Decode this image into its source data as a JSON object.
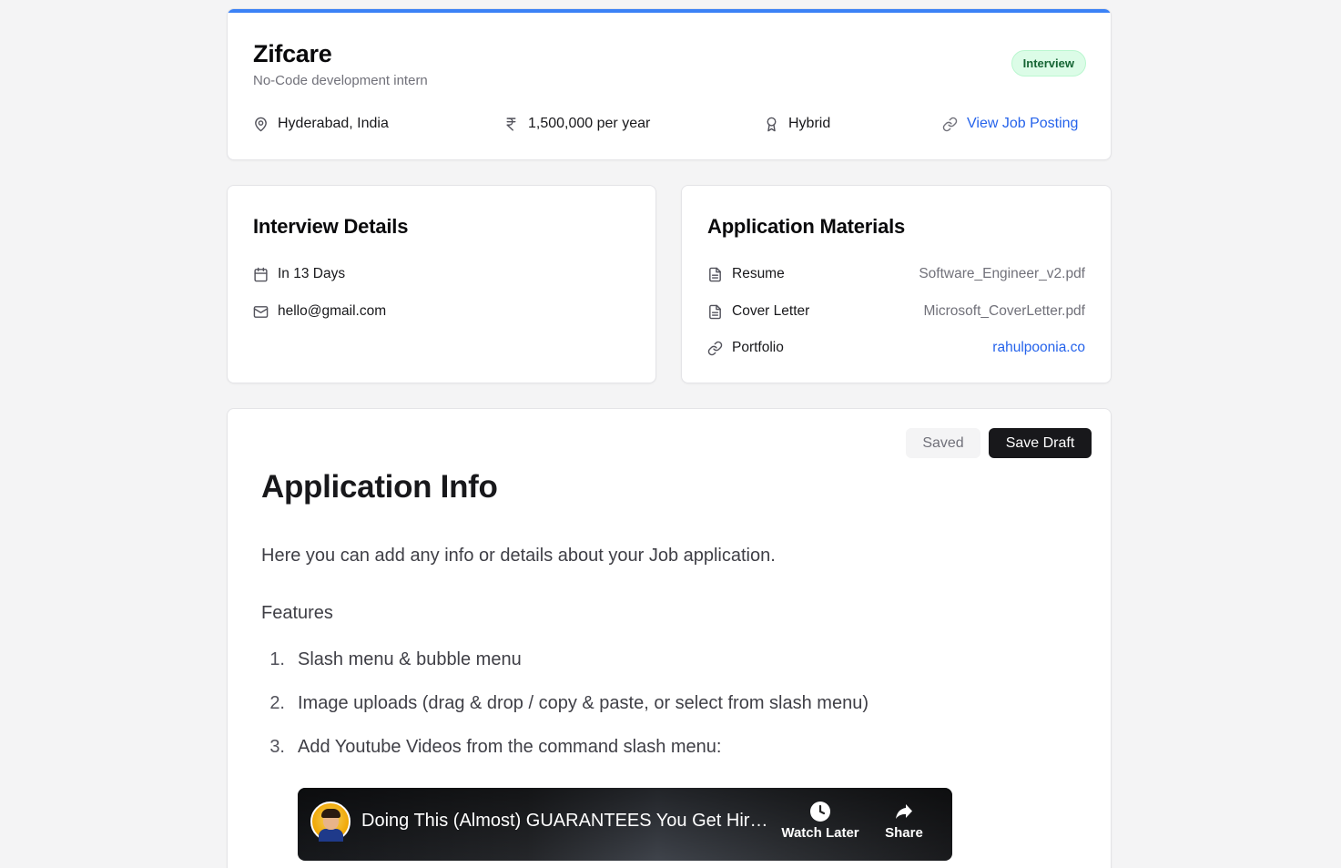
{
  "job": {
    "company": "Zifcare",
    "role": "No-Code development intern",
    "status": "Interview",
    "location": "Hyderabad, India",
    "salary": "1,500,000 per year",
    "work_mode": "Hybrid",
    "posting_link": "View Job Posting",
    "accent_color": "#3b82f6"
  },
  "interview": {
    "title": "Interview Details",
    "when": "In 13 Days",
    "contact": "hello@gmail.com"
  },
  "materials": {
    "title": "Application Materials",
    "items": [
      {
        "label": "Resume",
        "value": "Software_Engineer_v2.pdf",
        "icon": "file-icon"
      },
      {
        "label": "Cover Letter",
        "value": "Microsoft_CoverLetter.pdf",
        "icon": "file-icon"
      },
      {
        "label": "Portfolio",
        "value": "rahulpoonia.co",
        "icon": "link-icon"
      }
    ]
  },
  "editor": {
    "saved_label": "Saved",
    "save_draft_label": "Save Draft",
    "heading": "Application Info",
    "intro": "Here you can add any info or details about your Job application.",
    "features_label": "Features",
    "list": [
      {
        "num": "1.",
        "text": "Slash menu & bubble menu"
      },
      {
        "num": "2.",
        "text": "Image uploads (drag & drop / copy & paste, or select from slash menu)"
      },
      {
        "num": "3.",
        "text": "Add Youtube Videos from the command slash menu:"
      }
    ],
    "video": {
      "title": "Doing This (Almost) GUARANTEES You Get Hire...",
      "watch_later": "Watch Later",
      "share": "Share"
    }
  }
}
